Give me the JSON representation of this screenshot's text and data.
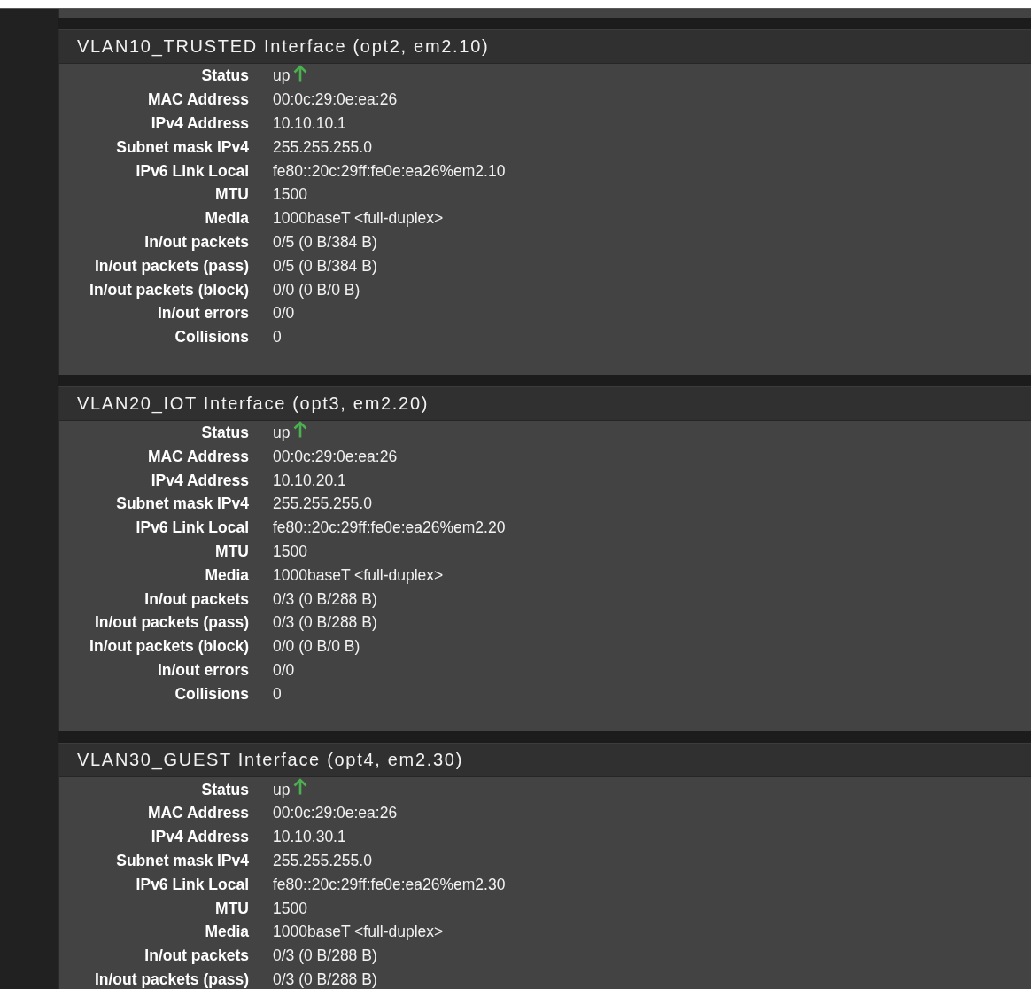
{
  "interfaces": [
    {
      "title": "VLAN10_TRUSTED Interface (opt2, em2.10)",
      "rows": [
        {
          "kind": "status",
          "label": "Status",
          "value": "up",
          "up": true
        },
        {
          "kind": "text",
          "label": "MAC Address",
          "value": "00:0c:29:0e:ea:26"
        },
        {
          "kind": "text",
          "label": "IPv4 Address",
          "value": "10.10.10.1"
        },
        {
          "kind": "text",
          "label": "Subnet mask IPv4",
          "value": "255.255.255.0"
        },
        {
          "kind": "text",
          "label": "IPv6 Link Local",
          "value": "fe80::20c:29ff:fe0e:ea26%em2.10"
        },
        {
          "kind": "text",
          "label": "MTU",
          "value": "1500"
        },
        {
          "kind": "text",
          "label": "Media",
          "value": "1000baseT <full-duplex>"
        },
        {
          "kind": "text",
          "label": "In/out packets",
          "value": "0/5 (0 B/384 B)"
        },
        {
          "kind": "text",
          "label": "In/out packets (pass)",
          "value": "0/5 (0 B/384 B)"
        },
        {
          "kind": "text",
          "label": "In/out packets (block)",
          "value": "0/0 (0 B/0 B)"
        },
        {
          "kind": "text",
          "label": "In/out errors",
          "value": "0/0"
        },
        {
          "kind": "text",
          "label": "Collisions",
          "value": "0"
        }
      ]
    },
    {
      "title": "VLAN20_IOT Interface (opt3, em2.20)",
      "rows": [
        {
          "kind": "status",
          "label": "Status",
          "value": "up",
          "up": true
        },
        {
          "kind": "text",
          "label": "MAC Address",
          "value": "00:0c:29:0e:ea:26"
        },
        {
          "kind": "text",
          "label": "IPv4 Address",
          "value": "10.10.20.1"
        },
        {
          "kind": "text",
          "label": "Subnet mask IPv4",
          "value": "255.255.255.0"
        },
        {
          "kind": "text",
          "label": "IPv6 Link Local",
          "value": "fe80::20c:29ff:fe0e:ea26%em2.20"
        },
        {
          "kind": "text",
          "label": "MTU",
          "value": "1500"
        },
        {
          "kind": "text",
          "label": "Media",
          "value": "1000baseT <full-duplex>"
        },
        {
          "kind": "text",
          "label": "In/out packets",
          "value": "0/3 (0 B/288 B)"
        },
        {
          "kind": "text",
          "label": "In/out packets (pass)",
          "value": "0/3 (0 B/288 B)"
        },
        {
          "kind": "text",
          "label": "In/out packets (block)",
          "value": "0/0 (0 B/0 B)"
        },
        {
          "kind": "text",
          "label": "In/out errors",
          "value": "0/0"
        },
        {
          "kind": "text",
          "label": "Collisions",
          "value": "0"
        }
      ]
    },
    {
      "title": "VLAN30_GUEST Interface (opt4, em2.30)",
      "rows": [
        {
          "kind": "status",
          "label": "Status",
          "value": "up",
          "up": true
        },
        {
          "kind": "text",
          "label": "MAC Address",
          "value": "00:0c:29:0e:ea:26"
        },
        {
          "kind": "text",
          "label": "IPv4 Address",
          "value": "10.10.30.1"
        },
        {
          "kind": "text",
          "label": "Subnet mask IPv4",
          "value": "255.255.255.0"
        },
        {
          "kind": "text",
          "label": "IPv6 Link Local",
          "value": "fe80::20c:29ff:fe0e:ea26%em2.30"
        },
        {
          "kind": "text",
          "label": "MTU",
          "value": "1500"
        },
        {
          "kind": "text",
          "label": "Media",
          "value": "1000baseT <full-duplex>"
        },
        {
          "kind": "text",
          "label": "In/out packets",
          "value": "0/3 (0 B/288 B)"
        },
        {
          "kind": "text",
          "label": "In/out packets (pass)",
          "value": "0/3 (0 B/288 B)"
        }
      ]
    }
  ]
}
